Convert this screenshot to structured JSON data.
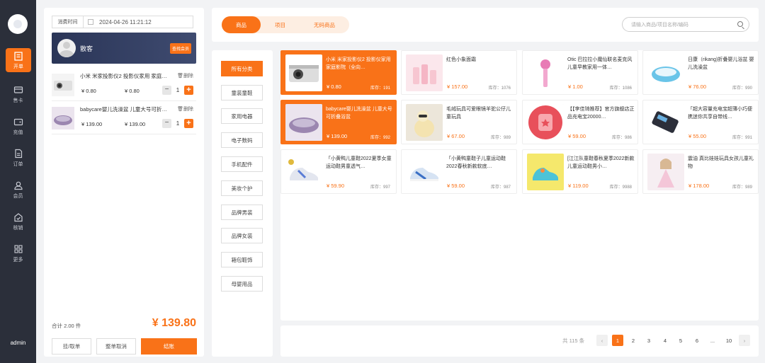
{
  "nav": {
    "items": [
      {
        "label": "开单",
        "icon": "register-icon"
      },
      {
        "label": "售卡",
        "icon": "card-icon"
      },
      {
        "label": "充值",
        "icon": "wallet-icon"
      },
      {
        "label": "订单",
        "icon": "order-icon"
      },
      {
        "label": "会员",
        "icon": "member-icon"
      },
      {
        "label": "核销",
        "icon": "verify-icon"
      },
      {
        "label": "更多",
        "icon": "grid-icon"
      }
    ],
    "admin": "admin"
  },
  "cart": {
    "time_label": "消费时间",
    "time_value": "2024-04-26 11:21:12",
    "member_name": "散客",
    "member_button": "查找会员",
    "lines": [
      {
        "name": "小米 米家投影仪2 投影仪家用 家庭影院（全向…",
        "price": "¥ 0.80",
        "subtotal": "¥ 0.80",
        "qty": "1",
        "delete": "删除"
      },
      {
        "name": "babycare婴儿洗澡盆 儿童大号可折叠浴盆",
        "price": "¥ 139.00",
        "subtotal": "¥ 139.00",
        "qty": "1",
        "delete": "删除"
      }
    ],
    "total_label": "合计 2.00 件",
    "total_value": "¥ 139.80",
    "buttons": {
      "hold": "挂/取单",
      "cancel": "整单取消",
      "checkout": "结账"
    }
  },
  "top": {
    "tabs": [
      "商品",
      "项目",
      "无码商品"
    ],
    "search_placeholder": "请输入商品/项目名称/编码"
  },
  "categories": [
    "所有分类",
    "童装童鞋",
    "家用电器",
    "电子数码",
    "手机配件",
    "美妆个护",
    "品牌男装",
    "品牌女装",
    "箱包鞋饰",
    "母婴用品"
  ],
  "products": [
    {
      "name": "小米 米家投影仪2 投影仪家用 家庭影院（全向…",
      "price": "¥ 0.80",
      "stock": "库存：191",
      "selected": true,
      "icon": "projector-image"
    },
    {
      "name": "红色小象面霜",
      "price": "¥ 157.00",
      "stock": "库存：1076",
      "selected": false,
      "icon": "cream-image"
    },
    {
      "name": "Otic 巴拉拉小魔仙联名麦克风儿童早教家用一体…",
      "price": "¥ 1.00",
      "stock": "库存：1086",
      "selected": false,
      "icon": "microphone-image"
    },
    {
      "name": "日康（rikang)折叠婴儿浴盆 婴儿洗澡盆",
      "price": "¥ 76.00",
      "stock": "库存：990",
      "selected": false,
      "icon": "bathtub-image"
    },
    {
      "name": "babycare婴儿洗澡盆 儿童大号可折叠浴盆",
      "price": "¥ 139.00",
      "stock": "库存：992",
      "selected": true,
      "icon": "bathtub-image"
    },
    {
      "name": "毛绒玩具可爱眼镜羊驼公仔儿童玩具",
      "price": "¥ 67.00",
      "stock": "库存：989",
      "selected": false,
      "icon": "plush-image"
    },
    {
      "name": "【【李佳琦推荐】官方旗舰店正品充电宝20000…",
      "price": "¥ 59.00",
      "stock": "库存：986",
      "selected": false,
      "icon": "powerbank-image"
    },
    {
      "name": "「超大容量充电宝超薄小巧便携迷你共享自带线…",
      "price": "¥ 55.00",
      "stock": "库存：991",
      "selected": false,
      "icon": "powerbank2-image"
    },
    {
      "name": "「小黄鸭儿童鞋2022夏季女童运动鞋男童透气…",
      "price": "¥ 59.90",
      "stock": "库存：997",
      "selected": false,
      "icon": "shoe-image"
    },
    {
      "name": "「小黄鸭童鞋子儿童运动鞋2022春秋新款软底…",
      "price": "¥ 59.00",
      "stock": "库存：987",
      "selected": false,
      "icon": "shoe-image"
    },
    {
      "name": "[江江队童鞋春秋夏季2022新款儿童运动鞋男小…",
      "price": "¥ 119.00",
      "stock": "库存：9988",
      "selected": false,
      "icon": "shoe-image"
    },
    {
      "name": "震油 真比娃娃玩具女孩儿童礼物",
      "price": "¥ 178.00",
      "stock": "库存：989",
      "selected": false,
      "icon": "doll-image"
    }
  ],
  "pagination": {
    "total": "共 115 条",
    "pages": [
      "1",
      "2",
      "3",
      "4",
      "5",
      "6",
      "...",
      "10"
    ],
    "current": "1",
    "prev": "‹",
    "next": "›"
  },
  "colors": {
    "accent": "#f97218",
    "sidebar": "#2b2f3a",
    "member_card": "#2f3a5c"
  }
}
